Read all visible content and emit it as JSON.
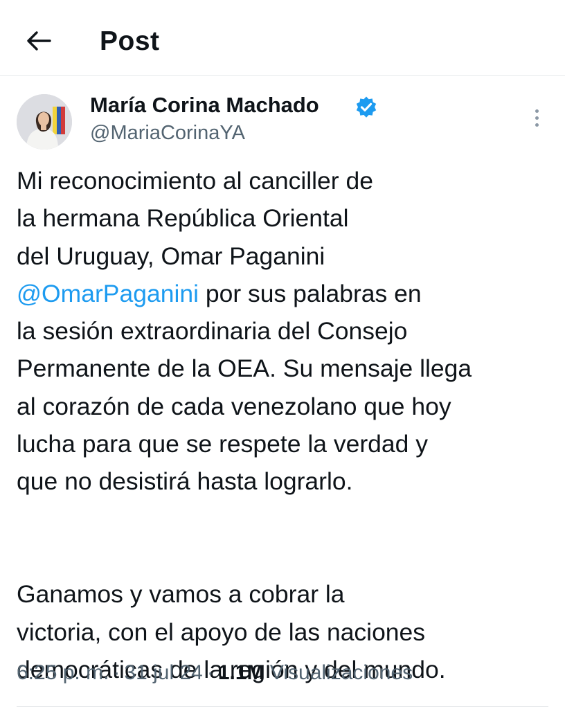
{
  "header": {
    "title": "Post",
    "back_icon": "arrow-left-icon"
  },
  "author": {
    "name": "María Corina Machado",
    "handle": "@MariaCorinaYA",
    "verified": true,
    "verified_color": "#1d9bf0"
  },
  "tweet": {
    "paragraph1": [
      "Mi reconocimiento al canciller de",
      "la hermana República Oriental",
      "del Uruguay, Omar Paganini",
      "por sus palabras en",
      "la sesión extraordinaria del Consejo",
      "Permanente de la OEA. Su mensaje llega",
      "al corazón de cada venezolano que hoy",
      "lucha para que se respete la verdad y",
      "que no desistirá hasta lograrlo."
    ],
    "mention": "@OmarPaganini",
    "paragraph2": [
      "Ganamos y vamos a cobrar la",
      "victoria, con el apoyo de las naciones",
      "democráticas de la región y del mundo."
    ]
  },
  "meta": {
    "time": "6:25 p. m.",
    "date": "31 jul 24",
    "views_count": "1.1M",
    "views_label": "Visualizaciones",
    "separator": "·"
  },
  "colors": {
    "link": "#1d9bf0",
    "secondary_text": "#536471",
    "primary_text": "#0f1419"
  }
}
